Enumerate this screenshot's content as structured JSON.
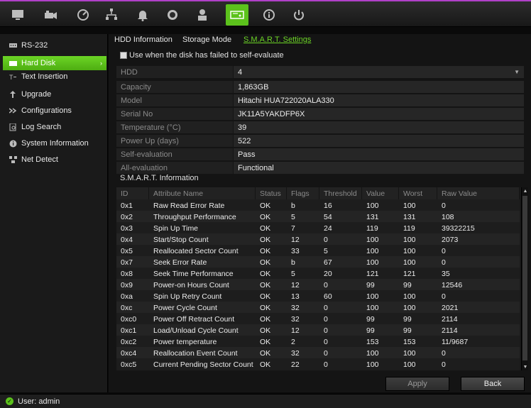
{
  "colors": {
    "accent": "#5cc21c",
    "top_border": "#b040c8",
    "label_gray": "#8a8a8a"
  },
  "topbar": {
    "icons": [
      {
        "name": "monitor-icon"
      },
      {
        "name": "camera-icon"
      },
      {
        "name": "playback-icon"
      },
      {
        "name": "network-icon"
      },
      {
        "name": "alarm-bell-icon"
      },
      {
        "name": "record-icon"
      },
      {
        "name": "user-icon"
      },
      {
        "name": "hdd-icon",
        "active": true
      },
      {
        "name": "info-icon"
      },
      {
        "name": "power-icon"
      }
    ]
  },
  "sidebar": {
    "items": [
      {
        "label": "RS-232",
        "icon": "rs232-icon"
      },
      {
        "label": "Hard Disk",
        "icon": "harddisk-icon",
        "active": true
      },
      {
        "label": "Text Insertion",
        "icon": "text-insertion-icon"
      },
      {
        "label": "Upgrade",
        "icon": "upgrade-icon"
      },
      {
        "label": "Configurations",
        "icon": "configurations-icon"
      },
      {
        "label": "Log Search",
        "icon": "log-search-icon"
      },
      {
        "label": "System Information",
        "icon": "system-information-icon"
      },
      {
        "label": "Net Detect",
        "icon": "net-detect-icon"
      }
    ]
  },
  "tabs": [
    {
      "label": "HDD Information"
    },
    {
      "label": "Storage Mode"
    },
    {
      "label": "S.M.A.R.T. Settings",
      "active": true
    }
  ],
  "checkbox": {
    "label": "Use when the disk has failed to self-evaluate",
    "checked": false
  },
  "info": [
    {
      "label": "HDD",
      "value": "4",
      "select": true
    },
    {
      "label": "Capacity",
      "value": "1,863GB"
    },
    {
      "label": "Model",
      "value": "Hitachi HUA722020ALA330"
    },
    {
      "label": "Serial No",
      "value": "JK11A5YAKDFP6X"
    },
    {
      "label": "Temperature (°C)",
      "value": "39"
    },
    {
      "label": "Power Up (days)",
      "value": "522"
    },
    {
      "label": "Self-evaluation",
      "value": "Pass"
    },
    {
      "label": "All-evaluation",
      "value": "Functional"
    }
  ],
  "smart": {
    "title": "S.M.A.R.T. Information",
    "columns": [
      "ID",
      "Attribute Name",
      "Status",
      "Flags",
      "Threshold",
      "Value",
      "Worst",
      "Raw Value"
    ],
    "rows": [
      [
        "0x1",
        "Raw Read Error Rate",
        "OK",
        "b",
        "16",
        "100",
        "100",
        "0"
      ],
      [
        "0x2",
        "Throughput Performance",
        "OK",
        "5",
        "54",
        "131",
        "131",
        "108"
      ],
      [
        "0x3",
        "Spin Up Time",
        "OK",
        "7",
        "24",
        "119",
        "119",
        "39322215"
      ],
      [
        "0x4",
        "Start/Stop Count",
        "OK",
        "12",
        "0",
        "100",
        "100",
        "2073"
      ],
      [
        "0x5",
        "Reallocated Sector Count",
        "OK",
        "33",
        "5",
        "100",
        "100",
        "0"
      ],
      [
        "0x7",
        "Seek Error Rate",
        "OK",
        "b",
        "67",
        "100",
        "100",
        "0"
      ],
      [
        "0x8",
        "Seek Time Performance",
        "OK",
        "5",
        "20",
        "121",
        "121",
        "35"
      ],
      [
        "0x9",
        "Power-on Hours Count",
        "OK",
        "12",
        "0",
        "99",
        "99",
        "12546"
      ],
      [
        "0xa",
        "Spin Up Retry Count",
        "OK",
        "13",
        "60",
        "100",
        "100",
        "0"
      ],
      [
        "0xc",
        "Power Cycle Count",
        "OK",
        "32",
        "0",
        "100",
        "100",
        "2021"
      ],
      [
        "0xc0",
        "Power Off Retract Count",
        "OK",
        "32",
        "0",
        "99",
        "99",
        "2114"
      ],
      [
        "0xc1",
        "Load/Unload Cycle Count",
        "OK",
        "12",
        "0",
        "99",
        "99",
        "2114"
      ],
      [
        "0xc2",
        "Power temperature",
        "OK",
        "2",
        "0",
        "153",
        "153",
        "11/9687"
      ],
      [
        "0xc4",
        "Reallocation Event Count",
        "OK",
        "32",
        "0",
        "100",
        "100",
        "0"
      ],
      [
        "0xc5",
        "Current Pending Sector Count",
        "OK",
        "22",
        "0",
        "100",
        "100",
        "0"
      ]
    ]
  },
  "buttons": {
    "apply": "Apply",
    "back": "Back"
  },
  "status": {
    "user_text": "User: admin"
  }
}
